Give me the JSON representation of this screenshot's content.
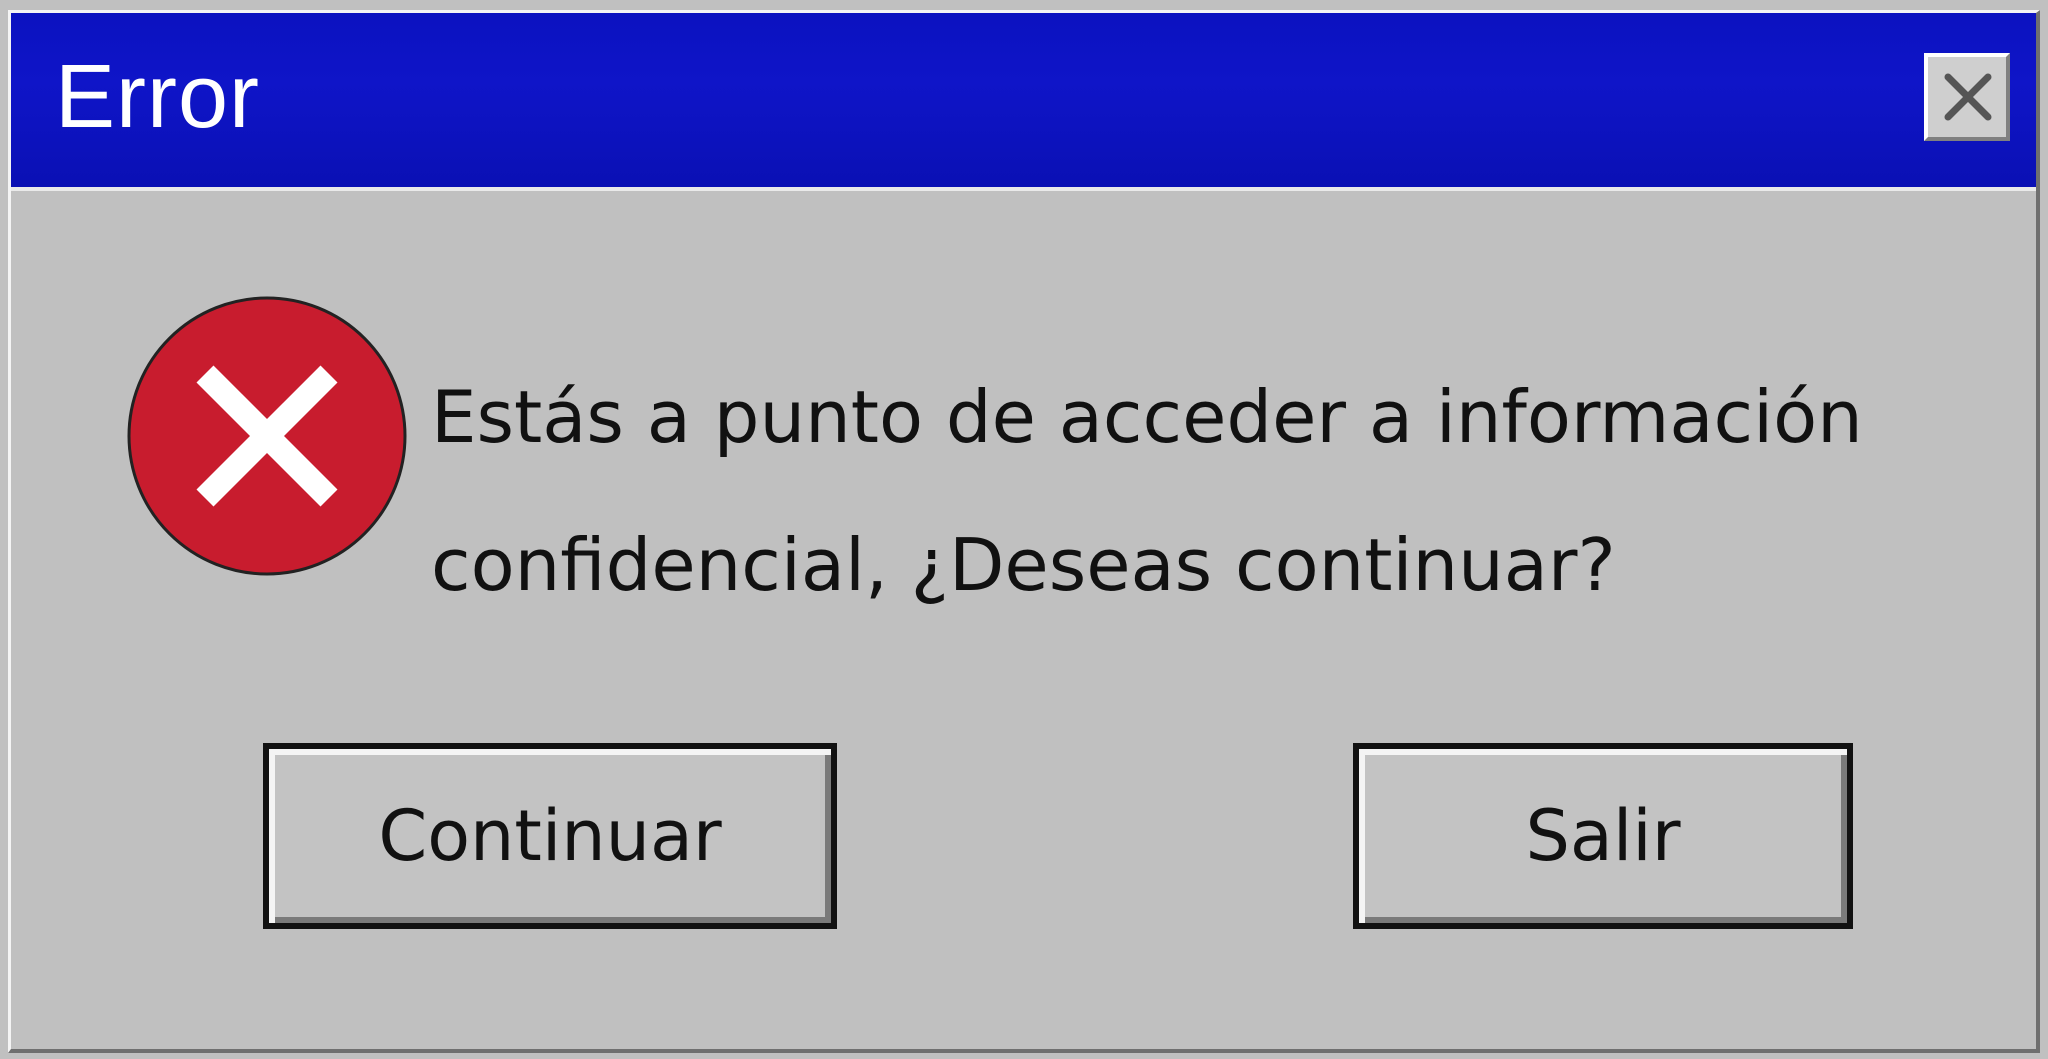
{
  "window": {
    "title": "Error"
  },
  "titlebar": {
    "close_icon": "close-icon",
    "color": "#0b12c0"
  },
  "message": {
    "icon": "error-icon",
    "icon_color": "#c81c2e",
    "line1": "Estás a punto de acceder a información",
    "line2": "confidencial, ¿Deseas continuar?"
  },
  "buttons": {
    "continue_label": "Continuar",
    "exit_label": "Salir"
  },
  "colors": {
    "background": "#c0c0c0",
    "title_text": "#ffffff"
  }
}
